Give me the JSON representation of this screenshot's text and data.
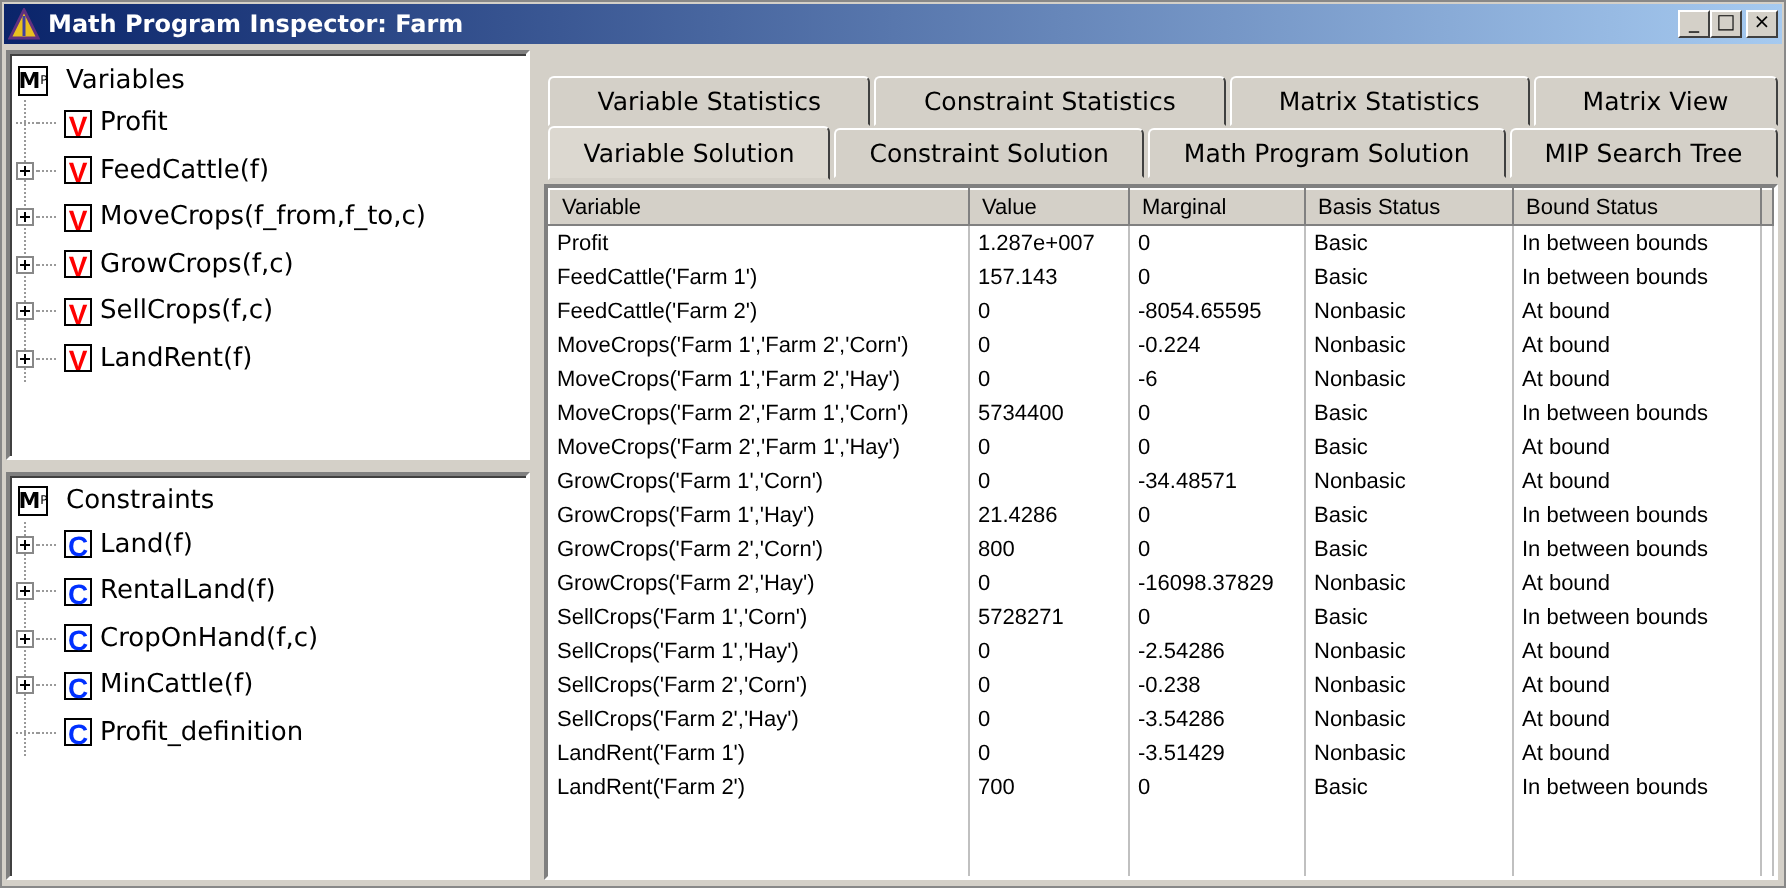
{
  "window": {
    "title": "Math Program Inspector: Farm",
    "controls": [
      "_",
      "□",
      "×"
    ]
  },
  "trees": [
    {
      "kind": "variable",
      "root_icon": [
        "M",
        "P"
      ],
      "title": "Variables",
      "items": [
        {
          "icon": "V",
          "label": "Profit",
          "expandable": false
        },
        {
          "icon": "V",
          "label": "FeedCattle(f)",
          "expandable": true
        },
        {
          "icon": "V",
          "label": "MoveCrops(f_from,f_to,c)",
          "expandable": true
        },
        {
          "icon": "V",
          "label": "GrowCrops(f,c)",
          "expandable": true
        },
        {
          "icon": "V",
          "label": "SellCrops(f,c)",
          "expandable": true
        },
        {
          "icon": "V",
          "label": "LandRent(f)",
          "expandable": true
        }
      ]
    },
    {
      "kind": "constraint",
      "root_icon": [
        "M",
        "P"
      ],
      "title": "Constraints",
      "items": [
        {
          "icon": "C",
          "label": "Land(f)",
          "expandable": true
        },
        {
          "icon": "C",
          "label": "RentalLand(f)",
          "expandable": true
        },
        {
          "icon": "C",
          "label": "CropOnHand(f,c)",
          "expandable": true
        },
        {
          "icon": "C",
          "label": "MinCattle(f)",
          "expandable": true
        },
        {
          "icon": "C",
          "label": "Profit_definition",
          "expandable": false
        }
      ]
    }
  ],
  "tab_rows": [
    [
      {
        "label": "Variable Statistics",
        "selected": false
      },
      {
        "label": "Constraint Statistics",
        "selected": false
      },
      {
        "label": "Matrix Statistics",
        "selected": false
      },
      {
        "label": "Matrix View",
        "selected": false
      }
    ],
    [
      {
        "label": "Variable Solution",
        "selected": true
      },
      {
        "label": "Constraint Solution",
        "selected": false
      },
      {
        "label": "Math Program Solution",
        "selected": false
      },
      {
        "label": "MIP Search Tree",
        "selected": false
      }
    ]
  ],
  "table": {
    "columns": [
      "Variable",
      "Value",
      "Marginal",
      "Basis Status",
      "Bound Status"
    ],
    "rows": [
      [
        "Profit",
        "1.287e+007",
        "0",
        "Basic",
        "In between bounds"
      ],
      [
        "FeedCattle('Farm 1')",
        "157.143",
        "0",
        "Basic",
        "In between bounds"
      ],
      [
        "FeedCattle('Farm 2')",
        "0",
        "-8054.65595",
        "Nonbasic",
        "At bound"
      ],
      [
        "MoveCrops('Farm 1','Farm 2','Corn')",
        "0",
        "-0.224",
        "Nonbasic",
        "At bound"
      ],
      [
        "MoveCrops('Farm 1','Farm 2','Hay')",
        "0",
        "-6",
        "Nonbasic",
        "At bound"
      ],
      [
        "MoveCrops('Farm 2','Farm 1','Corn')",
        "5734400",
        "0",
        "Basic",
        "In between bounds"
      ],
      [
        "MoveCrops('Farm 2','Farm 1','Hay')",
        "0",
        "0",
        "Basic",
        "At bound"
      ],
      [
        "GrowCrops('Farm 1','Corn')",
        "0",
        "-34.48571",
        "Nonbasic",
        "At bound"
      ],
      [
        "GrowCrops('Farm 1','Hay')",
        "21.4286",
        "0",
        "Basic",
        "In between bounds"
      ],
      [
        "GrowCrops('Farm 2','Corn')",
        "800",
        "0",
        "Basic",
        "In between bounds"
      ],
      [
        "GrowCrops('Farm 2','Hay')",
        "0",
        "-16098.37829",
        "Nonbasic",
        "At bound"
      ],
      [
        "SellCrops('Farm 1','Corn')",
        "5728271",
        "0",
        "Basic",
        "In between bounds"
      ],
      [
        "SellCrops('Farm 1','Hay')",
        "0",
        "-2.54286",
        "Nonbasic",
        "At bound"
      ],
      [
        "SellCrops('Farm 2','Corn')",
        "0",
        "-0.238",
        "Nonbasic",
        "At bound"
      ],
      [
        "SellCrops('Farm 2','Hay')",
        "0",
        "-3.54286",
        "Nonbasic",
        "At bound"
      ],
      [
        "LandRent('Farm 1')",
        "0",
        "-3.51429",
        "Nonbasic",
        "At bound"
      ],
      [
        "LandRent('Farm 2')",
        "700",
        "0",
        "Basic",
        "In between bounds"
      ]
    ]
  }
}
